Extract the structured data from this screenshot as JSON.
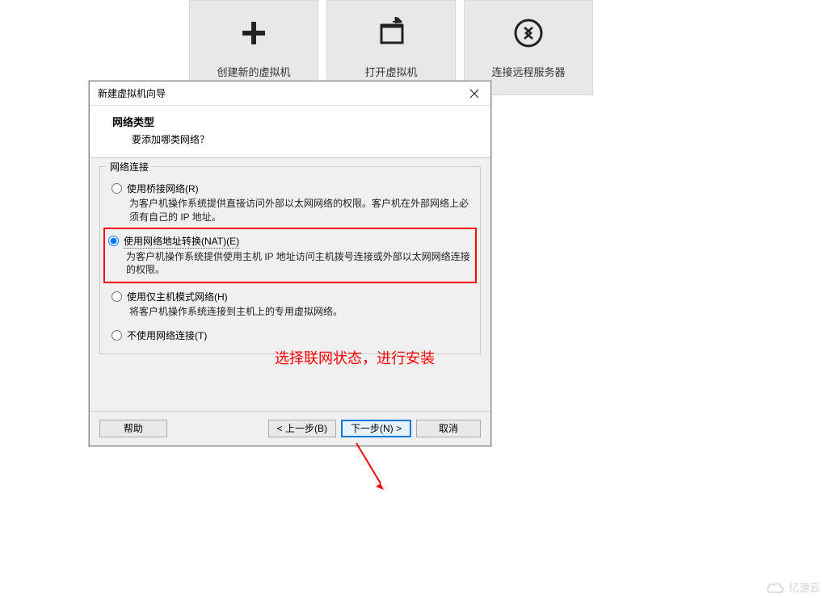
{
  "tiles": [
    {
      "label": "创建新的虚拟机",
      "icon": "plus-icon"
    },
    {
      "label": "打开虚拟机",
      "icon": "folder-open-icon"
    },
    {
      "label": "连接远程服务器",
      "icon": "remote-server-icon"
    }
  ],
  "dialog": {
    "title": "新建虚拟机向导",
    "header_title": "网络类型",
    "header_sub": "要添加哪类网络？",
    "group_label": "网络连接",
    "options": [
      {
        "label": "使用桥接网络(R)",
        "desc": "为客户机操作系统提供直接访问外部以太网网络的权限。客户机在外部网络上必须有自己的 IP 地址。",
        "checked": false
      },
      {
        "label": "使用网络地址转换(NAT)(E)",
        "desc": "为客户机操作系统提供使用主机 IP 地址访问主机拨号连接或外部以太网网络连接的权限。",
        "checked": true,
        "highlighted": true
      },
      {
        "label": "使用仅主机模式网络(H)",
        "desc": "将客户机操作系统连接到主机上的专用虚拟网络。",
        "checked": false
      },
      {
        "label": "不使用网络连接(T)",
        "desc": "",
        "checked": false
      }
    ],
    "footer": {
      "help": "帮助",
      "back": "< 上一步(B)",
      "next": "下一步(N) >",
      "cancel": "取消"
    }
  },
  "annotation": "选择联网状态，进行安装",
  "watermark": "亿速云"
}
